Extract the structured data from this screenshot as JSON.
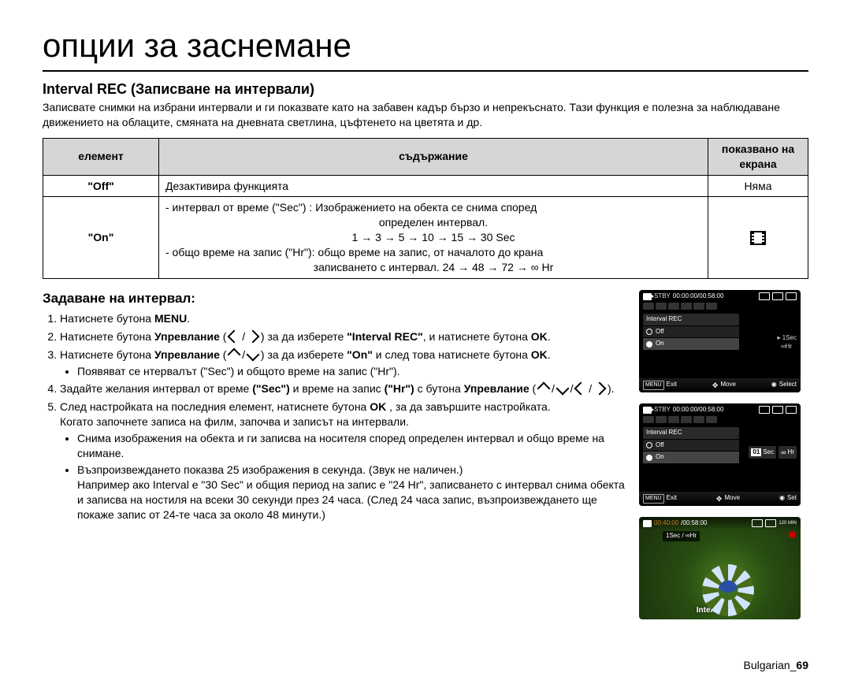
{
  "title": "опции за заснемане",
  "section_title": "Interval REC (Записване на интервали)",
  "intro": "Записвате снимки на избрани интервали и ги показвате като на забавен кадър бързо и непрекъснато. Тази функция е полезна за наблюдаване движението на облаците, смяната на дневната светлина, цъфтенето на цветята и др.",
  "table": {
    "head": {
      "col1": "елемент",
      "col2": "съдържание",
      "col3": "показвано на екрана"
    },
    "off": {
      "label": "\"Off\"",
      "content": "Дезактивира функцията",
      "display": "Няма"
    },
    "on": {
      "label": "\"On\"",
      "line1": "-  интервал от време (\"Sec\") : Изображението на обекта се снима според",
      "line1c": "определен интервал.",
      "seq": "1 → 3 → 5 → 10 → 15 → 30 Sec",
      "line2": "-  общо време на запис (\"Hr\"): общо време на запис, от началото до крана",
      "line2c": "записването с интервал. 24 → 48 → 72 → ∞ Hr"
    }
  },
  "howto": {
    "title": "Задаване на интервал:",
    "step1_a": "Натиснете бутона ",
    "step1_b": "MENU",
    "step1_c": ".",
    "step2_a": "Натиснете бутона ",
    "step2_b": "Упревлание",
    "step2_c": " ( ",
    "step2_d": " / ",
    "step2_e": " ) за да изберете ",
    "step2_f": "\"Interval REC\"",
    "step2_g": ", и натиснете бутона ",
    "step2_h": "OK",
    "step2_i": ".",
    "step3_a": "Натиснете бутона ",
    "step3_b": "Упревлание",
    "step3_c": " ( ",
    "step3_d": " / ",
    "step3_e": " ) за да изберете ",
    "step3_f": "\"On\"",
    "step3_g": " и след това натиснете бутона ",
    "step3_h": "OK",
    "step3_i": ".",
    "step3_bul": "Появяват се нтервалът (\"Sec\") и общото време на запис (\"Hr\").",
    "step4_a": "Задайте желания интервал от време ",
    "step4_b": "(\"Sec\")",
    "step4_c": " и време на запис ",
    "step4_d": "(\"Hr\")",
    "step4_e": " с бутона ",
    "step4_f": "Упревлание",
    "step4_g": " ( ",
    "step4_h": " / ",
    "step4_i": " / ",
    "step4_j": " / ",
    "step4_k": " ).",
    "step5_a": "След настройката на последния елемент, натиснете бутона ",
    "step5_b": "OK",
    "step5_c": " , за да завършите настройката.",
    "step5_line2": "Когато започнете записа на филм, започва и записът на интервали.",
    "step5_bul1": "Снима изображения на обекта и ги записва на носителя според определен интервал и общо време на снимане.",
    "step5_bul2a": "Възпроизвеждането показва 25 изображения в секунда. (Звук не наличен.)",
    "step5_bul2b": "Например ако Interval е \"30 Sec\" и общия период на запис е \"24 Hr\", записването с интервал снима обекта и записва на ностиля на всеки 30 секунди през 24 часа. (След 24 часа запис, възпроизвеждането ще покаже запис от 24-те часа за около 48 минути.)"
  },
  "lcd": {
    "stby": "STBY",
    "time": "00:00:00/00:58:00",
    "panel_title": "Interval REC",
    "off": "Off",
    "on": "On",
    "side1a": "1Sec",
    "side1b": "∞Hr",
    "sec_num": "01",
    "sec_lbl": "Sec",
    "hr_inf": "∞",
    "hr_lbl": "Hr",
    "menu": "MENU",
    "exit": "Exit",
    "move": "Move",
    "select": "Select",
    "set": "Set"
  },
  "lcd3": {
    "time1": "00:40:00",
    "time2": "/00:58:00",
    "bar": "1Sec / ∞Hr",
    "caption": "Interval REC",
    "min": "120 MIN"
  },
  "footer": {
    "lang": "Bulgarian_",
    "page": "69"
  }
}
